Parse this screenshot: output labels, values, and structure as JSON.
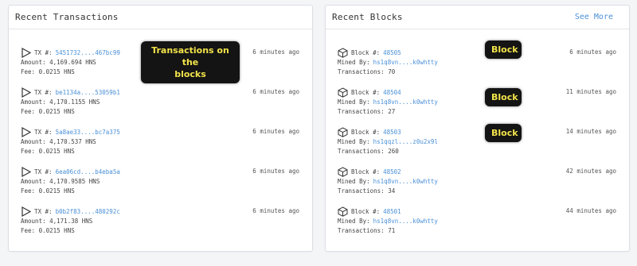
{
  "transactions": {
    "title": "Recent Transactions",
    "rows": [
      {
        "tx_label": "TX #:",
        "hash": "5451732....467bc99",
        "amount": "Amount: 4,169.694 HNS",
        "fee": "Fee: 0.0215 HNS",
        "time": "6 minutes ago"
      },
      {
        "tx_label": "TX #:",
        "hash": "be1134a....53059b1",
        "amount": "Amount: 4,170.1155 HNS",
        "fee": "Fee: 0.0215 HNS",
        "time": "6 minutes ago"
      },
      {
        "tx_label": "TX #:",
        "hash": "5a8ae33....bc7a375",
        "amount": "Amount: 4,170.537 HNS",
        "fee": "Fee: 0.0215 HNS",
        "time": "6 minutes ago"
      },
      {
        "tx_label": "TX #:",
        "hash": "6ea06cd....b4eba5a",
        "amount": "Amount: 4,170.9585 HNS",
        "fee": "Fee: 0.0215 HNS",
        "time": "6 minutes ago"
      },
      {
        "tx_label": "TX #:",
        "hash": "b0b2f83....480292c",
        "amount": "Amount: 4,171.38 HNS",
        "fee": "Fee: 0.0215 HNS",
        "time": "6 minutes ago"
      }
    ]
  },
  "blocks": {
    "title": "Recent Blocks",
    "see_more": "See More",
    "rows": [
      {
        "block_label": "Block #:",
        "number": "48505",
        "miner_label": "Mined By:",
        "miner": "hs1q8vn....k0whtty",
        "txs": "Transactions: 70",
        "time": "6 minutes ago"
      },
      {
        "block_label": "Block #:",
        "number": "48504",
        "miner_label": "Mined By:",
        "miner": "hs1q8vn....k0whtty",
        "txs": "Transactions: 27",
        "time": "11 minutes ago"
      },
      {
        "block_label": "Block #:",
        "number": "48503",
        "miner_label": "Mined By:",
        "miner": "hs1qqzl....z0u2x9l",
        "txs": "Transactions: 260",
        "time": "14 minutes ago"
      },
      {
        "block_label": "Block #:",
        "number": "48502",
        "miner_label": "Mined By:",
        "miner": "hs1q8vn....k0whtty",
        "txs": "Transactions: 34",
        "time": "42 minutes ago"
      },
      {
        "block_label": "Block #:",
        "number": "48501",
        "miner_label": "Mined By:",
        "miner": "hs1q8vn....k0whtty",
        "txs": "Transactions: 71",
        "time": "44 minutes ago"
      }
    ]
  },
  "annotations": {
    "tx_callout_line1": "Transactions on the",
    "tx_callout_line2": "blocks",
    "block_callout_1": "Block",
    "block_callout_2": "Block",
    "block_callout_3": "Block"
  },
  "icons": {
    "transaction": "play-triangle-icon",
    "block": "cube-icon"
  },
  "colors": {
    "link": "#4a8fd6",
    "callout_bg": "#141414",
    "callout_text": "#f2e34a"
  }
}
